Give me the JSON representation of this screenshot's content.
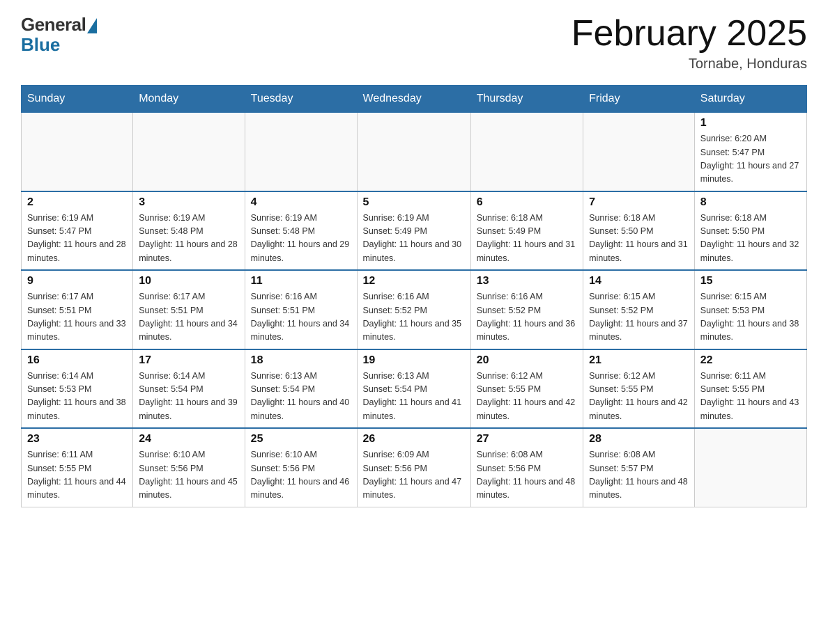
{
  "header": {
    "logo_general": "General",
    "logo_blue": "Blue",
    "month_title": "February 2025",
    "location": "Tornabe, Honduras"
  },
  "weekdays": [
    "Sunday",
    "Monday",
    "Tuesday",
    "Wednesday",
    "Thursday",
    "Friday",
    "Saturday"
  ],
  "weeks": [
    [
      {
        "day": "",
        "info": ""
      },
      {
        "day": "",
        "info": ""
      },
      {
        "day": "",
        "info": ""
      },
      {
        "day": "",
        "info": ""
      },
      {
        "day": "",
        "info": ""
      },
      {
        "day": "",
        "info": ""
      },
      {
        "day": "1",
        "info": "Sunrise: 6:20 AM\nSunset: 5:47 PM\nDaylight: 11 hours and 27 minutes."
      }
    ],
    [
      {
        "day": "2",
        "info": "Sunrise: 6:19 AM\nSunset: 5:47 PM\nDaylight: 11 hours and 28 minutes."
      },
      {
        "day": "3",
        "info": "Sunrise: 6:19 AM\nSunset: 5:48 PM\nDaylight: 11 hours and 28 minutes."
      },
      {
        "day": "4",
        "info": "Sunrise: 6:19 AM\nSunset: 5:48 PM\nDaylight: 11 hours and 29 minutes."
      },
      {
        "day": "5",
        "info": "Sunrise: 6:19 AM\nSunset: 5:49 PM\nDaylight: 11 hours and 30 minutes."
      },
      {
        "day": "6",
        "info": "Sunrise: 6:18 AM\nSunset: 5:49 PM\nDaylight: 11 hours and 31 minutes."
      },
      {
        "day": "7",
        "info": "Sunrise: 6:18 AM\nSunset: 5:50 PM\nDaylight: 11 hours and 31 minutes."
      },
      {
        "day": "8",
        "info": "Sunrise: 6:18 AM\nSunset: 5:50 PM\nDaylight: 11 hours and 32 minutes."
      }
    ],
    [
      {
        "day": "9",
        "info": "Sunrise: 6:17 AM\nSunset: 5:51 PM\nDaylight: 11 hours and 33 minutes."
      },
      {
        "day": "10",
        "info": "Sunrise: 6:17 AM\nSunset: 5:51 PM\nDaylight: 11 hours and 34 minutes."
      },
      {
        "day": "11",
        "info": "Sunrise: 6:16 AM\nSunset: 5:51 PM\nDaylight: 11 hours and 34 minutes."
      },
      {
        "day": "12",
        "info": "Sunrise: 6:16 AM\nSunset: 5:52 PM\nDaylight: 11 hours and 35 minutes."
      },
      {
        "day": "13",
        "info": "Sunrise: 6:16 AM\nSunset: 5:52 PM\nDaylight: 11 hours and 36 minutes."
      },
      {
        "day": "14",
        "info": "Sunrise: 6:15 AM\nSunset: 5:52 PM\nDaylight: 11 hours and 37 minutes."
      },
      {
        "day": "15",
        "info": "Sunrise: 6:15 AM\nSunset: 5:53 PM\nDaylight: 11 hours and 38 minutes."
      }
    ],
    [
      {
        "day": "16",
        "info": "Sunrise: 6:14 AM\nSunset: 5:53 PM\nDaylight: 11 hours and 38 minutes."
      },
      {
        "day": "17",
        "info": "Sunrise: 6:14 AM\nSunset: 5:54 PM\nDaylight: 11 hours and 39 minutes."
      },
      {
        "day": "18",
        "info": "Sunrise: 6:13 AM\nSunset: 5:54 PM\nDaylight: 11 hours and 40 minutes."
      },
      {
        "day": "19",
        "info": "Sunrise: 6:13 AM\nSunset: 5:54 PM\nDaylight: 11 hours and 41 minutes."
      },
      {
        "day": "20",
        "info": "Sunrise: 6:12 AM\nSunset: 5:55 PM\nDaylight: 11 hours and 42 minutes."
      },
      {
        "day": "21",
        "info": "Sunrise: 6:12 AM\nSunset: 5:55 PM\nDaylight: 11 hours and 42 minutes."
      },
      {
        "day": "22",
        "info": "Sunrise: 6:11 AM\nSunset: 5:55 PM\nDaylight: 11 hours and 43 minutes."
      }
    ],
    [
      {
        "day": "23",
        "info": "Sunrise: 6:11 AM\nSunset: 5:55 PM\nDaylight: 11 hours and 44 minutes."
      },
      {
        "day": "24",
        "info": "Sunrise: 6:10 AM\nSunset: 5:56 PM\nDaylight: 11 hours and 45 minutes."
      },
      {
        "day": "25",
        "info": "Sunrise: 6:10 AM\nSunset: 5:56 PM\nDaylight: 11 hours and 46 minutes."
      },
      {
        "day": "26",
        "info": "Sunrise: 6:09 AM\nSunset: 5:56 PM\nDaylight: 11 hours and 47 minutes."
      },
      {
        "day": "27",
        "info": "Sunrise: 6:08 AM\nSunset: 5:56 PM\nDaylight: 11 hours and 48 minutes."
      },
      {
        "day": "28",
        "info": "Sunrise: 6:08 AM\nSunset: 5:57 PM\nDaylight: 11 hours and 48 minutes."
      },
      {
        "day": "",
        "info": ""
      }
    ]
  ]
}
